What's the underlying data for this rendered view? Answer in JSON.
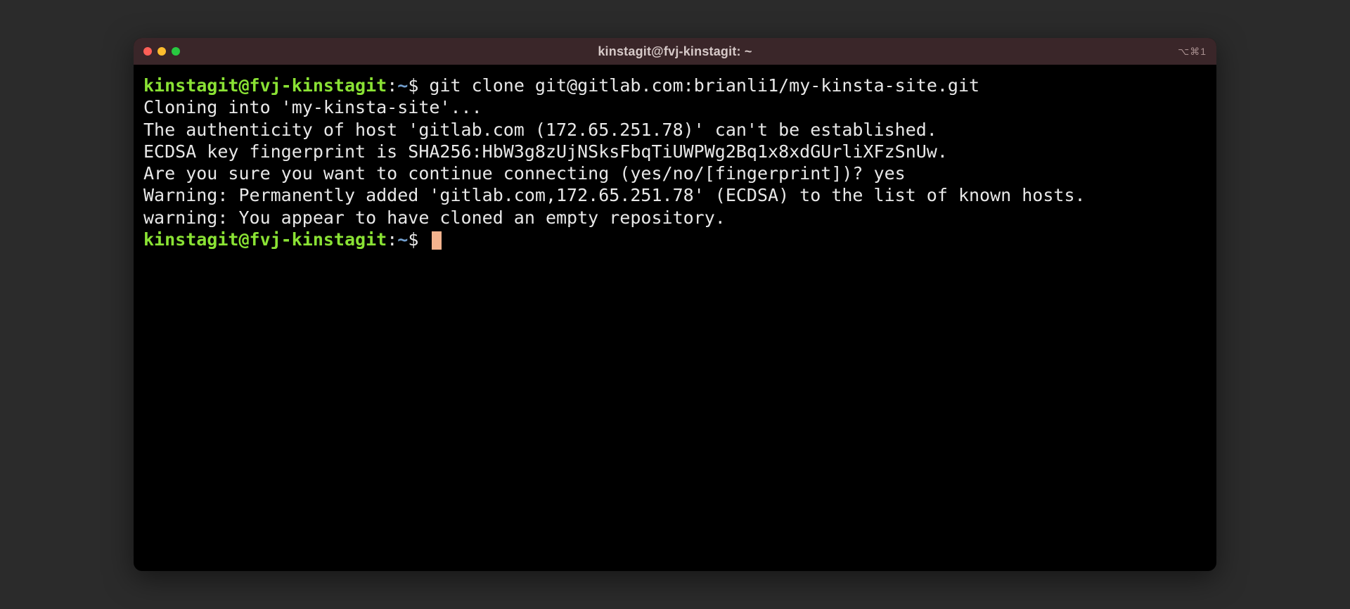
{
  "titlebar": {
    "title": "kinstagit@fvj-kinstagit: ~",
    "right_hint": "⌥⌘1"
  },
  "prompt1": {
    "userhost": "kinstagit@fvj-kinstagit",
    "sep": ":",
    "path": "~",
    "sign": "$ ",
    "command": "git clone git@gitlab.com:brianli1/my-kinsta-site.git"
  },
  "output": {
    "l1": "Cloning into 'my-kinsta-site'...",
    "l2": "The authenticity of host 'gitlab.com (172.65.251.78)' can't be established.",
    "l3": "ECDSA key fingerprint is SHA256:HbW3g8zUjNSksFbqTiUWPWg2Bq1x8xdGUrliXFzSnUw.",
    "l4": "Are you sure you want to continue connecting (yes/no/[fingerprint])? yes",
    "l5": "Warning: Permanently added 'gitlab.com,172.65.251.78' (ECDSA) to the list of known hosts.",
    "l6": "warning: You appear to have cloned an empty repository."
  },
  "prompt2": {
    "userhost": "kinstagit@fvj-kinstagit",
    "sep": ":",
    "path": "~",
    "sign": "$ "
  }
}
